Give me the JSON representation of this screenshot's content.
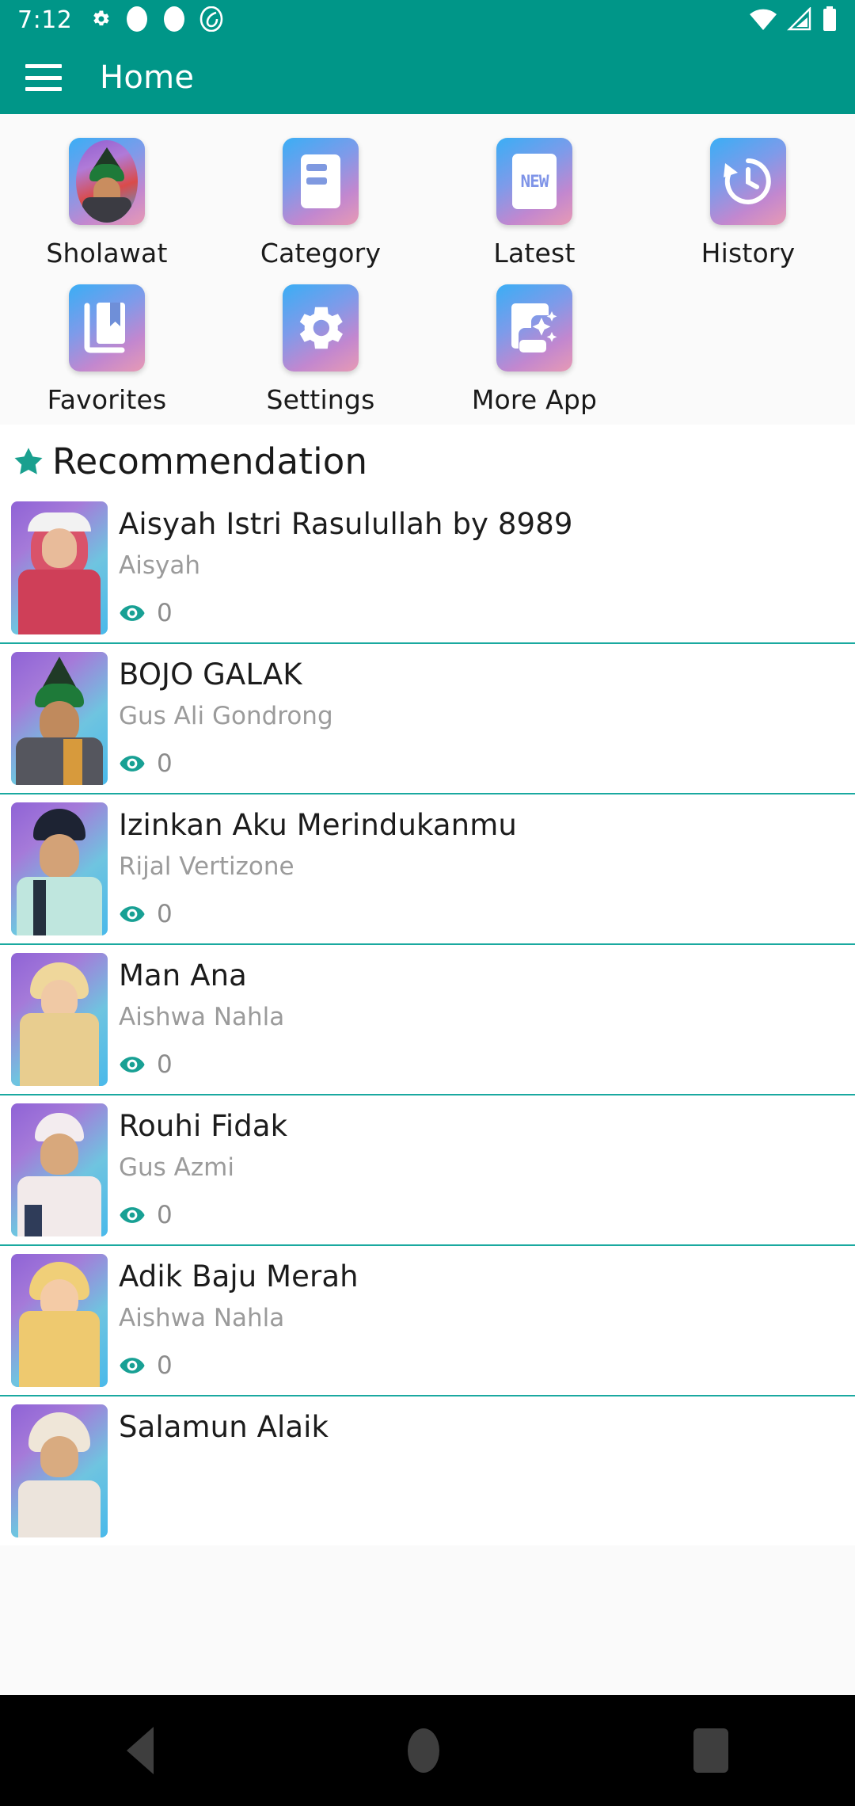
{
  "status_bar": {
    "time": "7:12",
    "left_icons": [
      "gear-icon",
      "circle-icon",
      "circle-icon",
      "spiral-icon"
    ],
    "right_icons": [
      "wifi-icon",
      "signal-icon",
      "battery-icon"
    ]
  },
  "app_bar": {
    "menu_icon": "hamburger-menu-icon",
    "title": "Home"
  },
  "grid_menu": {
    "items": [
      {
        "label": "Sholawat",
        "icon": "portrait-photo-icon"
      },
      {
        "label": "Category",
        "icon": "article-list-icon"
      },
      {
        "label": "Latest",
        "icon": "new-badge-icon",
        "badge_text": "NEW"
      },
      {
        "label": "History",
        "icon": "history-clock-icon"
      },
      {
        "label": "Favorites",
        "icon": "bookmark-book-icon"
      },
      {
        "label": "Settings",
        "icon": "gear-icon"
      },
      {
        "label": "More App",
        "icon": "sparkle-phone-icon"
      }
    ]
  },
  "recommendation": {
    "star_icon": "star-icon",
    "title": "Recommendation",
    "items": [
      {
        "title": "Aisyah Istri Rasulullah by 8989",
        "artist": "Aisyah",
        "views": "0",
        "views_icon": "eye-icon"
      },
      {
        "title": "BOJO GALAK",
        "artist": "Gus Ali Gondrong",
        "views": "0",
        "views_icon": "eye-icon"
      },
      {
        "title": "Izinkan Aku Merindukanmu",
        "artist": "Rijal Vertizone",
        "views": "0",
        "views_icon": "eye-icon"
      },
      {
        "title": "Man Ana",
        "artist": "Aishwa Nahla",
        "views": "0",
        "views_icon": "eye-icon"
      },
      {
        "title": "Rouhi Fidak",
        "artist": "Gus Azmi",
        "views": "0",
        "views_icon": "eye-icon"
      },
      {
        "title": "Adik Baju Merah",
        "artist": "Aishwa Nahla",
        "views": "0",
        "views_icon": "eye-icon"
      },
      {
        "title": "Salamun Alaik",
        "artist": "",
        "views": "",
        "views_icon": "eye-icon"
      }
    ]
  },
  "nav_bar": {
    "back_label": "Back",
    "home_label": "Home",
    "recents_label": "Recents"
  },
  "colors": {
    "primary_teal": "#009688",
    "accent_teal": "#1aa9a0",
    "divider": "#1aa9a0",
    "text_primary": "#1c1c1c",
    "text_secondary": "#9b9b9b"
  }
}
